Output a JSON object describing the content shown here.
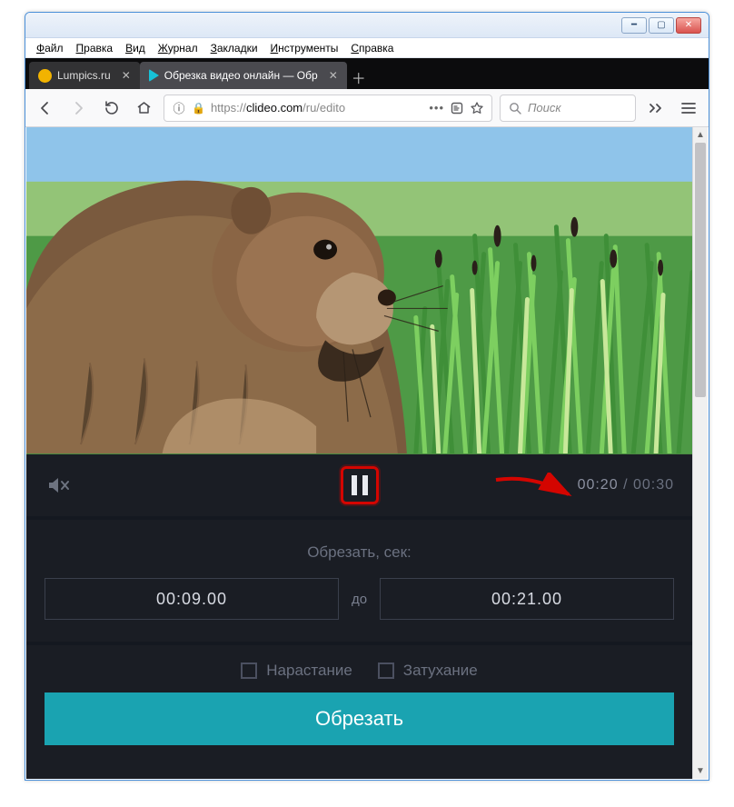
{
  "menubar": {
    "items": [
      "Файл",
      "Правка",
      "Вид",
      "Журнал",
      "Закладки",
      "Инструменты",
      "Справка"
    ]
  },
  "tabs": [
    {
      "title": "Lumpics.ru",
      "active": false
    },
    {
      "title": "Обрезка видео онлайн — Обр",
      "active": true
    }
  ],
  "url": {
    "proto": "https://",
    "host": "clideo.com",
    "path": "/ru/edito"
  },
  "search": {
    "placeholder": "Поиск"
  },
  "player": {
    "current_time": "00:20",
    "total_time": "00:30"
  },
  "trim": {
    "label": "Обрезать, сек:",
    "from": "00:09.00",
    "sep": "до",
    "to": "00:21.00"
  },
  "fade": {
    "in": "Нарастание",
    "out": "Затухание"
  },
  "cta": "Обрезать"
}
